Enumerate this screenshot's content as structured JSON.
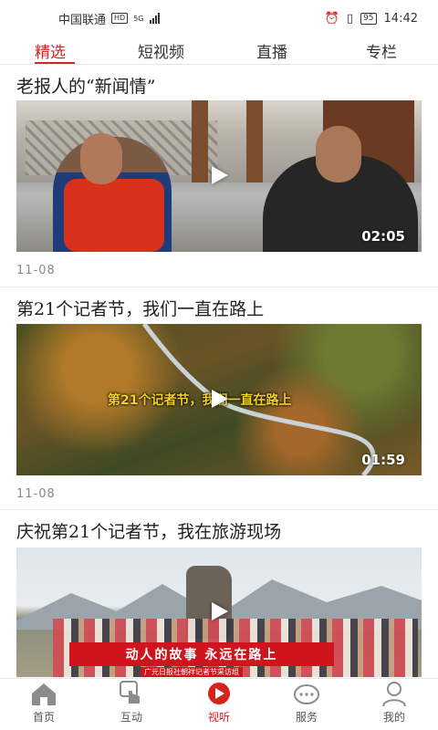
{
  "status_bar": {
    "carrier": "中国联通",
    "hd": "HD",
    "network": "5G",
    "battery": "95",
    "time": "14:42"
  },
  "top_tabs": [
    {
      "label": "精选",
      "active": true
    },
    {
      "label": "短视频",
      "active": false
    },
    {
      "label": "直播",
      "active": false
    },
    {
      "label": "专栏",
      "active": false
    }
  ],
  "feed": [
    {
      "title": "老报人的“新闻情”",
      "duration": "02:05",
      "date": "11-08"
    },
    {
      "title": "第21个记者节，我们一直在路上",
      "duration": "01:59",
      "date": "11-08",
      "caption": "第21个记者节，我们一直在路上"
    },
    {
      "title": "庆祝第21个记者节，我在旅游现场",
      "banner": "动人的故事 永远在路上",
      "banner_sub": "广元日报社朝祥记者节采访组"
    }
  ],
  "bottom_nav": [
    {
      "label": "首页",
      "icon": "home-icon",
      "active": false
    },
    {
      "label": "互动",
      "icon": "tap-icon",
      "active": false
    },
    {
      "label": "视听",
      "icon": "play-circle-icon",
      "active": true
    },
    {
      "label": "服务",
      "icon": "headset-chat-icon",
      "active": false
    },
    {
      "label": "我的",
      "icon": "user-icon",
      "active": false
    }
  ],
  "colors": {
    "accent": "#d6231d",
    "text": "#222222",
    "muted": "#8a8a8a"
  }
}
